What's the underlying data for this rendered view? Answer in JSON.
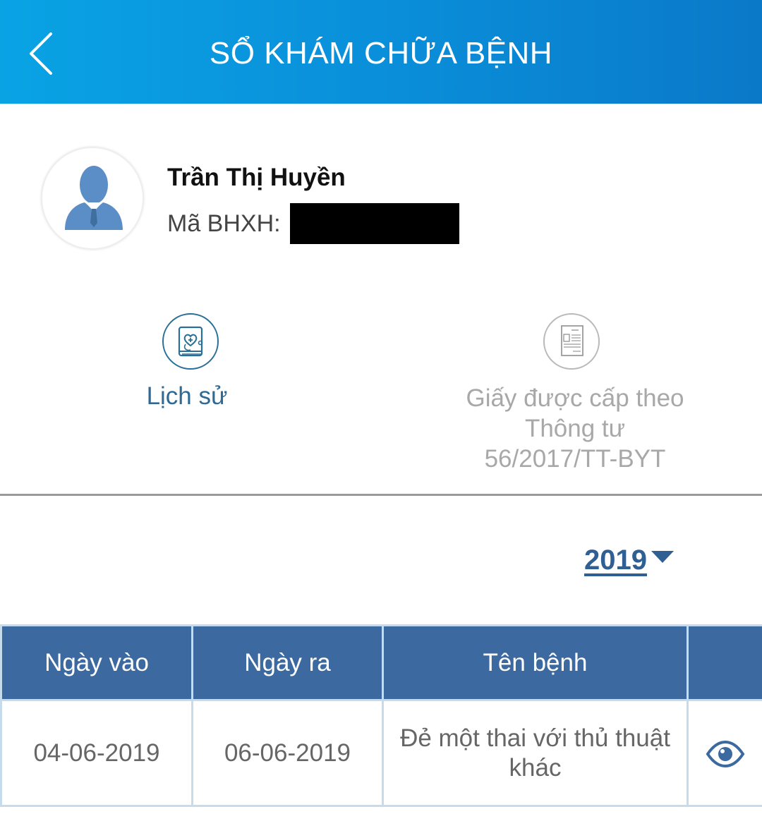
{
  "header": {
    "title": "SỔ KHÁM CHỮA BỆNH"
  },
  "user": {
    "name": "Trần Thị Huyền",
    "bhxh_label": "Mã BHXH:",
    "bhxh_value": ""
  },
  "menu": {
    "history_label": "Lịch sử",
    "certificate_label": "Giấy được cấp theo Thông tư 56/2017/TT-BYT"
  },
  "filter": {
    "year": "2019"
  },
  "table": {
    "columns": [
      "Ngày vào",
      "Ngày ra",
      "Tên bệnh",
      ""
    ],
    "rows": [
      {
        "date_in": "04-06-2019",
        "date_out": "06-06-2019",
        "disease": "Đẻ một thai với thủ thuật khác",
        "action_icon": "eye-icon"
      }
    ]
  },
  "colors": {
    "header_gradient_start": "#09a3e4",
    "header_gradient_end": "#0a79c8",
    "table_header": "#3c6aa0",
    "accent": "#2f5f93"
  }
}
